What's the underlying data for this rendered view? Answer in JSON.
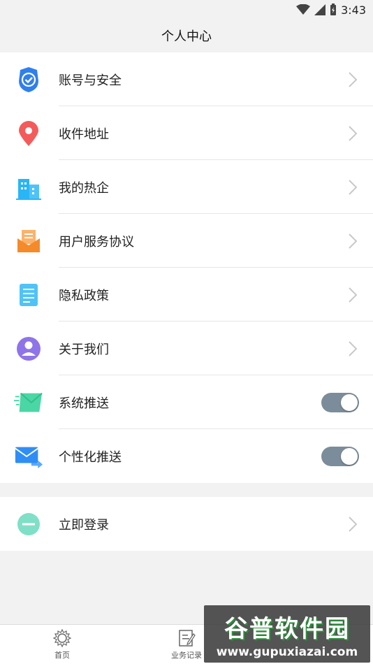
{
  "status_bar": {
    "time": "3:43"
  },
  "header": {
    "title": "个人中心"
  },
  "menu_group_1": [
    {
      "label": "账号与安全",
      "icon": "shield-check-icon",
      "trailing": "chevron"
    },
    {
      "label": "收件地址",
      "icon": "location-pin-icon",
      "trailing": "chevron"
    },
    {
      "label": "我的热企",
      "icon": "buildings-icon",
      "trailing": "chevron"
    },
    {
      "label": "用户服务协议",
      "icon": "document-envelope-icon",
      "trailing": "chevron"
    },
    {
      "label": "隐私政策",
      "icon": "document-list-icon",
      "trailing": "chevron"
    },
    {
      "label": "关于我们",
      "icon": "user-circle-icon",
      "trailing": "chevron"
    },
    {
      "label": "系统推送",
      "icon": "mail-fly-icon",
      "trailing": "toggle",
      "toggle_on": true
    },
    {
      "label": "个性化推送",
      "icon": "mail-forward-icon",
      "trailing": "toggle",
      "toggle_on": true
    }
  ],
  "menu_group_2": [
    {
      "label": "立即登录",
      "icon": "minus-circle-icon",
      "trailing": "chevron"
    }
  ],
  "tab_bar": {
    "items": [
      {
        "label": "首页",
        "icon": "sun-gear-icon"
      },
      {
        "label": "业务记录",
        "icon": "edit-note-icon"
      }
    ]
  },
  "watermark": {
    "title": "谷普软件园",
    "url": "www.gupuxiazai.com"
  },
  "colors": {
    "toggle_track": "#7b8d9a",
    "shield_blue": "#2f80ed",
    "pin_red": "#f45b5b",
    "building_cyan": "#29b6f6",
    "orange": "#f58a2b",
    "list_cyan": "#4fc3f7",
    "purple": "#8e74e8",
    "mint": "#4bd6a5",
    "mail_blue": "#2f8ef5",
    "mint_circle": "#7fe0c7"
  }
}
